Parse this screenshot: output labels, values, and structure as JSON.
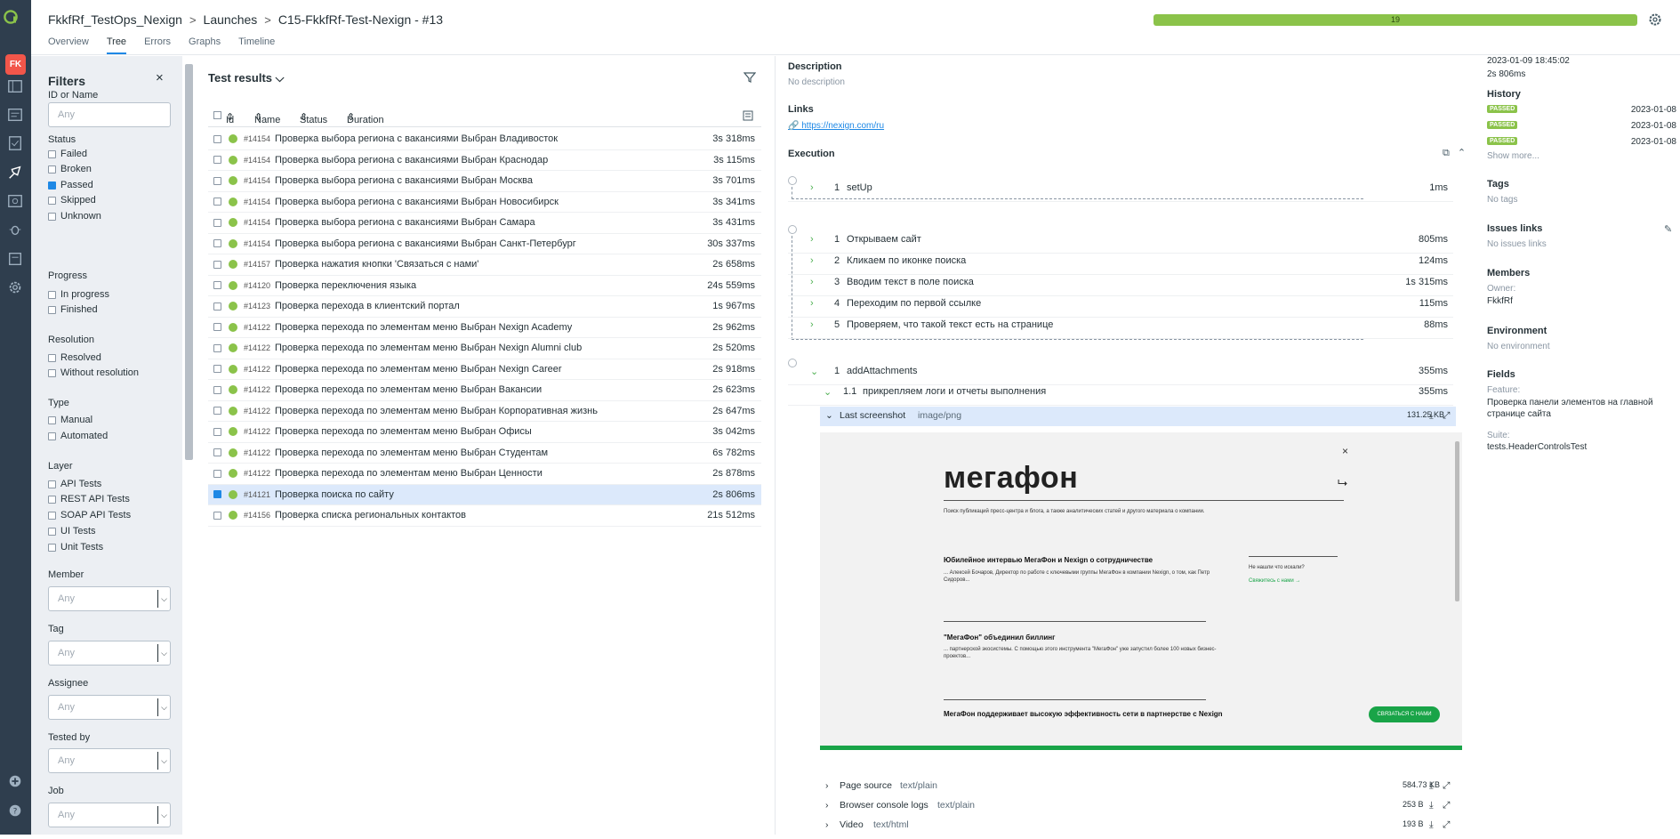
{
  "header": {
    "breadcrumb": [
      "FkkfRf_TestOps_Nexign",
      "Launches",
      "C15-FkkfRf-Test-Nexign - #13"
    ],
    "separator": ">",
    "tabs": [
      "Overview",
      "Tree",
      "Errors",
      "Graphs",
      "Timeline"
    ],
    "active_tab": "Tree",
    "progress_count": "19",
    "progress_fraction": 1.0
  },
  "sidebar": {
    "avatar": "FK"
  },
  "filters": {
    "title": "Filters",
    "close": "×",
    "id_label": "ID or Name",
    "id_placeholder": "Any",
    "status_label": "Status",
    "status": [
      "Failed",
      "Broken",
      "Passed",
      "Skipped",
      "Unknown"
    ],
    "progress_label": "Progress",
    "progress": [
      "In progress",
      "Finished"
    ],
    "resolution_label": "Resolution",
    "resolution": [
      "Resolved",
      "Without resolution"
    ],
    "type_label": "Type",
    "type": [
      "Manual",
      "Automated"
    ],
    "layer_label": "Layer",
    "layer": [
      "API Tests",
      "REST API Tests",
      "SOAP API Tests",
      "UI Tests",
      "Unit Tests"
    ],
    "member_label": "Member",
    "tag_label": "Tag",
    "assignee_label": "Assignee",
    "tested_by_label": "Tested by",
    "job_label": "Job",
    "any": "Any"
  },
  "results": {
    "title": "Test results",
    "columns": [
      "Id",
      "Name",
      "Status",
      "Duration"
    ],
    "rows": [
      {
        "id": "#14154",
        "name": "Проверка выбора региона с вакансиями Выбран Владивосток",
        "duration": "3s 318ms"
      },
      {
        "id": "#14154",
        "name": "Проверка выбора региона с вакансиями Выбран Краснодар",
        "duration": "3s 115ms"
      },
      {
        "id": "#14154",
        "name": "Проверка выбора региона с вакансиями Выбран Москва",
        "duration": "3s 701ms"
      },
      {
        "id": "#14154",
        "name": "Проверка выбора региона с вакансиями Выбран Новосибирск",
        "duration": "3s 341ms"
      },
      {
        "id": "#14154",
        "name": "Проверка выбора региона с вакансиями Выбран Самара",
        "duration": "3s 431ms"
      },
      {
        "id": "#14154",
        "name": "Проверка выбора региона с вакансиями Выбран Санкт-Петербург",
        "duration": "30s 337ms"
      },
      {
        "id": "#14157",
        "name": "Проверка нажатия кнопки 'Связаться с нами'",
        "duration": "2s 658ms"
      },
      {
        "id": "#14120",
        "name": "Проверка переключения языка",
        "duration": "24s 559ms"
      },
      {
        "id": "#14123",
        "name": "Проверка перехода в клиентский портал",
        "duration": "1s 967ms"
      },
      {
        "id": "#14122",
        "name": "Проверка перехода по элементам меню Выбран Nexign Academy",
        "duration": "2s 962ms"
      },
      {
        "id": "#14122",
        "name": "Проверка перехода по элементам меню Выбран Nexign Alumni club",
        "duration": "2s 520ms"
      },
      {
        "id": "#14122",
        "name": "Проверка перехода по элементам меню Выбран Nexign Career",
        "duration": "2s 918ms"
      },
      {
        "id": "#14122",
        "name": "Проверка перехода по элементам меню Выбран Вакансии",
        "duration": "2s 623ms"
      },
      {
        "id": "#14122",
        "name": "Проверка перехода по элементам меню Выбран Корпоративная жизнь",
        "duration": "2s 647ms"
      },
      {
        "id": "#14122",
        "name": "Проверка перехода по элементам меню Выбран Офисы",
        "duration": "3s 042ms"
      },
      {
        "id": "#14122",
        "name": "Проверка перехода по элементам меню Выбран Студентам",
        "duration": "6s 782ms"
      },
      {
        "id": "#14122",
        "name": "Проверка перехода по элементам меню Выбран Ценности",
        "duration": "2s 878ms"
      },
      {
        "id": "#14121",
        "name": "Проверка поиска по сайту",
        "duration": "2s 806ms",
        "selected": true
      },
      {
        "id": "#14156",
        "name": "Проверка списка региональных контактов",
        "duration": "21s 512ms"
      }
    ]
  },
  "details": {
    "description_label": "Description",
    "description": "No description",
    "links_label": "Links",
    "link": "https://nexign.com/ru",
    "execution_label": "Execution",
    "setup": {
      "num": "1",
      "name": "setUp",
      "duration": "1ms"
    },
    "steps": [
      {
        "num": "1",
        "name": "Открываем сайт",
        "duration": "805ms"
      },
      {
        "num": "2",
        "name": "Кликаем по иконке поиска",
        "duration": "124ms"
      },
      {
        "num": "3",
        "name": "Вводим текст в поле поиска",
        "duration": "1s 315ms"
      },
      {
        "num": "4",
        "name": "Переходим по первой ссылке",
        "duration": "115ms"
      },
      {
        "num": "5",
        "name": "Проверяем, что такой текст есть на странице",
        "duration": "88ms"
      }
    ],
    "teardown": {
      "num": "1",
      "name": "addAttachments",
      "duration": "355ms"
    },
    "substep": {
      "num": "1.1",
      "name": "прикрепляем логи и отчеты выполнения",
      "duration": "355ms"
    },
    "attachments": [
      {
        "name": "Last screenshot",
        "mime": "image/png",
        "size": "131.25 KB"
      },
      {
        "name": "Page source",
        "mime": "text/plain",
        "size": "584.73 KB"
      },
      {
        "name": "Browser console logs",
        "mime": "text/plain",
        "size": "253 B"
      },
      {
        "name": "Video",
        "mime": "text/html",
        "size": "193 B"
      }
    ],
    "screenshot": {
      "brand": "мегафон",
      "close": "×",
      "subtitle": "Поиск публикаций пресс-центра и блога, а также аналитических статей и другого материала о компании.",
      "h1": "Юбилейное интервью МегаФон и Nexign о сотрудничестве",
      "p1": "... Алексей Бочаров, Директор по работе с ключевыми группы МегаФон в компании Nexign, о том, как Петр Сидоров...",
      "side_q": "Не нашли что искали?",
      "side_link": "Свяжитесь с нами →",
      "h2": "\"МегаФон\" объединил биллинг",
      "p2": "... партнерской экосистемы. С помощью этого инструмента \"МегаФон\" уже запустил более 100 новых бизнес-проектов...",
      "h3": "МегаФон поддерживает высокую эффективность сети в партнерстве с Nexign",
      "button": "СВЯЗАТЬСЯ С НАМИ"
    }
  },
  "meta": {
    "date": "2023-01-09 18:45:02",
    "duration": "2s 806ms",
    "history_label": "History",
    "history": [
      {
        "status": "PASSED",
        "date": "2023-01-08"
      },
      {
        "status": "PASSED",
        "date": "2023-01-08"
      },
      {
        "status": "PASSED",
        "date": "2023-01-08"
      }
    ],
    "show_more": "Show more...",
    "tags_label": "Tags",
    "tags": "No tags",
    "issues_label": "Issues links",
    "issues": "No issues links",
    "members_label": "Members",
    "owner_label": "Owner:",
    "owner": "FkkfRf",
    "env_label": "Environment",
    "env": "No environment",
    "fields_label": "Fields",
    "feature_label": "Feature:",
    "feature": "Проверка панели элементов на главной странице сайта",
    "suite_label": "Suite:",
    "suite": "tests.HeaderControlsTest"
  }
}
